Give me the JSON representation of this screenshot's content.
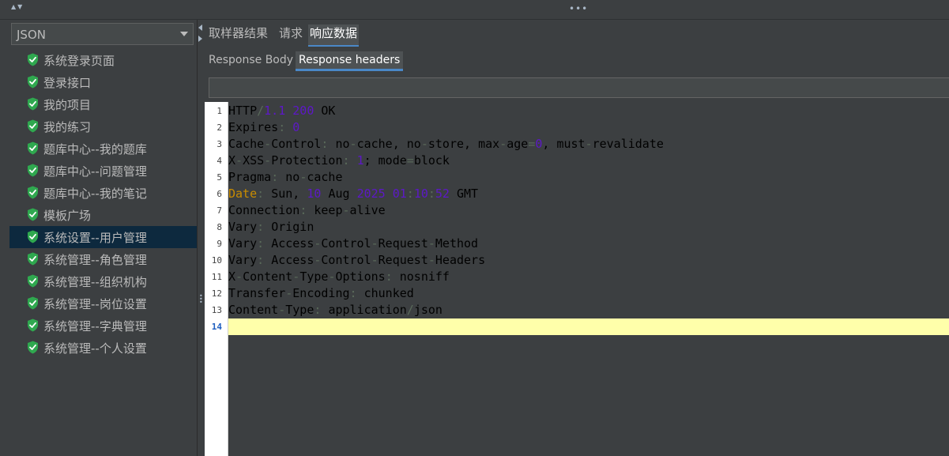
{
  "sampler_type_select": {
    "value": "JSON"
  },
  "tree": {
    "items": [
      {
        "label": "系统登录页面",
        "selected": false
      },
      {
        "label": "登录接口",
        "selected": false
      },
      {
        "label": "我的项目",
        "selected": false
      },
      {
        "label": "我的练习",
        "selected": false
      },
      {
        "label": "题库中心--我的题库",
        "selected": false
      },
      {
        "label": "题库中心--问题管理",
        "selected": false
      },
      {
        "label": "题库中心--我的笔记",
        "selected": false
      },
      {
        "label": "模板广场",
        "selected": false
      },
      {
        "label": "系统设置--用户管理",
        "selected": true
      },
      {
        "label": "系统管理--角色管理",
        "selected": false
      },
      {
        "label": "系统管理--组织机构",
        "selected": false
      },
      {
        "label": "系统管理--岗位设置",
        "selected": false
      },
      {
        "label": "系统管理--字典管理",
        "selected": false
      },
      {
        "label": "系统管理--个人设置",
        "selected": false
      }
    ]
  },
  "result_tabs": {
    "items": [
      "取样器结果",
      "请求",
      "响应数据"
    ],
    "active_index": 2
  },
  "response_tabs": {
    "items": [
      "Response Body",
      "Response headers"
    ],
    "active_index": 1
  },
  "search": {
    "value": ""
  },
  "editor": {
    "current_line": 14,
    "lines": [
      {
        "n": "1",
        "text": "HTTP/1.1 200 OK"
      },
      {
        "n": "2",
        "text": "Expires: 0"
      },
      {
        "n": "3",
        "text": "Cache-Control: no-cache, no-store, max-age=0, must-revalidate"
      },
      {
        "n": "4",
        "text": "X-XSS-Protection: 1; mode=block"
      },
      {
        "n": "5",
        "text": "Pragma: no-cache"
      },
      {
        "n": "6",
        "text": "Date: Sun, 10 Aug 2025 01:10:52 GMT"
      },
      {
        "n": "7",
        "text": "Connection: keep-alive"
      },
      {
        "n": "8",
        "text": "Vary: Origin"
      },
      {
        "n": "9",
        "text": "Vary: Access-Control-Request-Method"
      },
      {
        "n": "10",
        "text": "Vary: Access-Control-Request-Headers"
      },
      {
        "n": "11",
        "text": "X-Content-Type-Options: nosniff"
      },
      {
        "n": "12",
        "text": "Transfer-Encoding: chunked"
      },
      {
        "n": "13",
        "text": "Content-Type: application/json"
      },
      {
        "n": "14",
        "text": ""
      }
    ]
  },
  "colors": {
    "background": "#3c3f41",
    "selection": "#0d293e",
    "check_icon": "#2fa84f",
    "tab_underline": "#4a88c7",
    "current_line": "#ffffaa",
    "number_token": "#5d18c8",
    "date_token": "#c98c00"
  },
  "icons": {
    "tree_item": "green-shield-check-icon",
    "select_caret": "chevron-down-icon"
  }
}
